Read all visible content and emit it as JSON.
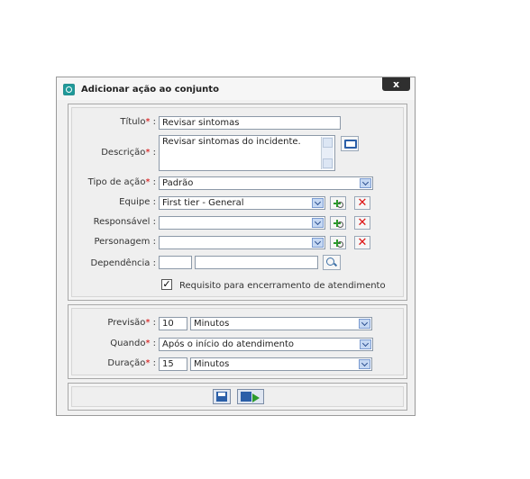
{
  "dialog": {
    "title": "Adicionar ação ao conjunto",
    "close_label": "x"
  },
  "form": {
    "titulo": {
      "label": "Título",
      "value": "Revisar sintomas"
    },
    "descricao": {
      "label": "Descrição",
      "value": "Revisar sintomas do incidente."
    },
    "tipo_acao": {
      "label": "Tipo de ação",
      "value": "Padrão"
    },
    "equipe": {
      "label": "Equipe",
      "value": "First tier - General"
    },
    "responsavel": {
      "label": "Responsável",
      "value": ""
    },
    "personagem": {
      "label": "Personagem",
      "value": ""
    },
    "dependencia": {
      "label": "Dependência",
      "code": "",
      "value": ""
    },
    "requisito": {
      "checked": true,
      "label": "Requisito para encerramento de atendimento"
    }
  },
  "timing": {
    "previsao": {
      "label": "Previsão",
      "value": "10",
      "unit": "Minutos"
    },
    "quando": {
      "label": "Quando",
      "value": "Após o início do atendimento"
    },
    "duracao": {
      "label": "Duração",
      "value": "15",
      "unit": "Minutos"
    }
  },
  "colors": {
    "required_star": "#d40000",
    "close_bg": "#2f2f2f",
    "accent": "#1e9a9a"
  },
  "icons": [
    "app-icon",
    "close-icon",
    "book-icon",
    "add-icon",
    "delete-icon",
    "search-icon",
    "save-icon",
    "save-close-icon"
  ]
}
